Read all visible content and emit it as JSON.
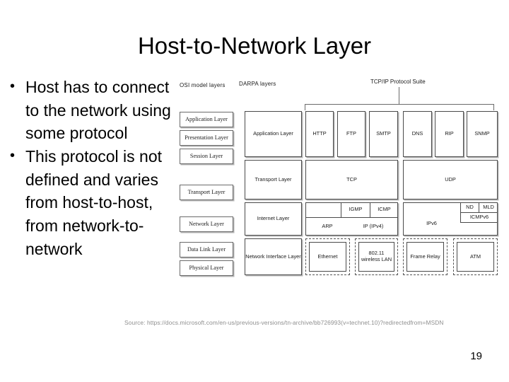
{
  "slide": {
    "title": "Host-to-Network Layer",
    "number": "19",
    "source": "Source: https://docs.microsoft.com/en-us/previous-versions/tn-archive/bb726993(v=technet.10)?redirectedfrom=MSDN"
  },
  "bullets": [
    {
      "marker": "•",
      "text": "Host has to connect to the network using some protocol"
    },
    {
      "marker": "•",
      "text": "This protocol is not defined and varies from host-to-host, from network-to-network"
    }
  ],
  "diagram": {
    "headings": {
      "osi": "OSI model layers",
      "darpa": "DARPA layers",
      "suite": "TCP/IP Protocol Suite"
    },
    "osi_layers": [
      "Application Layer",
      "Presentation Layer",
      "Session Layer",
      "Transport Layer",
      "Network Layer",
      "Data Link Layer",
      "Physical Layer"
    ],
    "darpa_layers": [
      "Application Layer",
      "Transport Layer",
      "Internet Layer",
      "Network Interface Layer"
    ],
    "application_protocols": [
      "HTTP",
      "FTP",
      "SMTP",
      "DNS",
      "RIP",
      "SNMP"
    ],
    "transport_protocols": [
      "TCP",
      "UDP"
    ],
    "internet_ipv4": {
      "igmp": "IGMP",
      "icmp": "ICMP",
      "arp": "ARP",
      "ip": "IP (IPv4)"
    },
    "internet_ipv6": {
      "nd": "ND",
      "mld": "MLD",
      "icmpv6": "ICMPv6",
      "ipv6": "IPv6"
    },
    "network_interfaces": [
      "Ethernet",
      "802.11 wireless LAN",
      "Frame Relay",
      "ATM"
    ]
  },
  "colors": {
    "background": "#ffffff",
    "text": "#000000",
    "diagram_line": "#4a4a4a",
    "source_text": "#8f8f8f"
  }
}
